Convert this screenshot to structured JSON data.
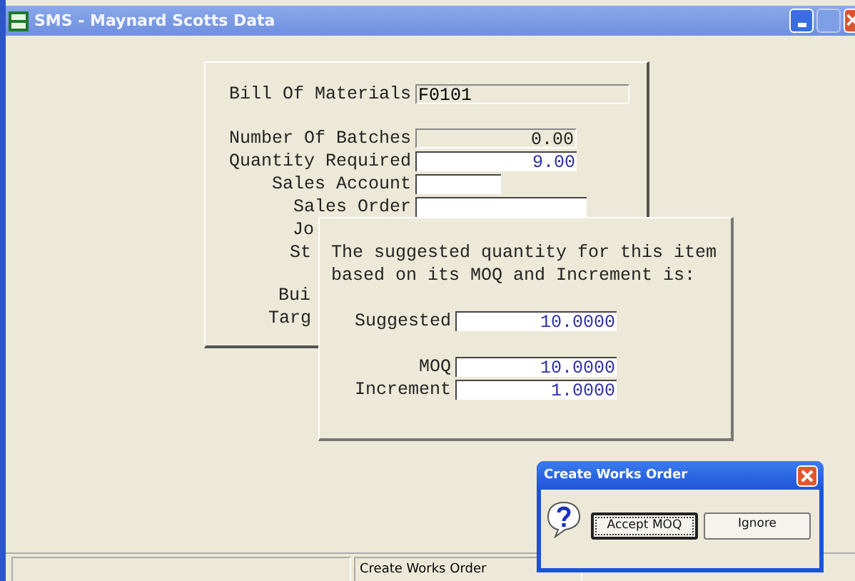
{
  "window": {
    "title": "SMS - Maynard Scotts Data"
  },
  "form": {
    "fields": [
      {
        "label": "Bill Of Materials",
        "value": "F0101",
        "kind": "code",
        "readonly": true
      },
      {
        "label": "Number Of Batches",
        "value": "0.00",
        "kind": "number",
        "readonly": true
      },
      {
        "label": "Quantity Required",
        "value": "9.00",
        "kind": "number",
        "readonly": false
      },
      {
        "label": "Sales Account",
        "kind": "short",
        "readonly": false
      },
      {
        "label": "Sales Order",
        "kind": "long",
        "readonly": false
      },
      {
        "label": "Jo",
        "kind": "covered"
      },
      {
        "label": "St",
        "kind": "covered"
      },
      {
        "label": "Bui",
        "kind": "covered"
      },
      {
        "label": "Targ",
        "kind": "covered"
      }
    ]
  },
  "popup": {
    "message": "The suggested quantity for this item based on its MOQ and Increment is:",
    "fields": [
      {
        "label": "Suggested",
        "value": "10.0000"
      },
      {
        "label": "MOQ",
        "value": "10.0000"
      },
      {
        "label": "Increment",
        "value": "1.0000"
      }
    ]
  },
  "dialog": {
    "title": "Create Works Order",
    "buttons": [
      {
        "label": "Accept MOQ",
        "focused": true
      },
      {
        "label": "Ignore",
        "focused": false
      }
    ]
  },
  "status_bar": {
    "text": "Create Works Order"
  }
}
